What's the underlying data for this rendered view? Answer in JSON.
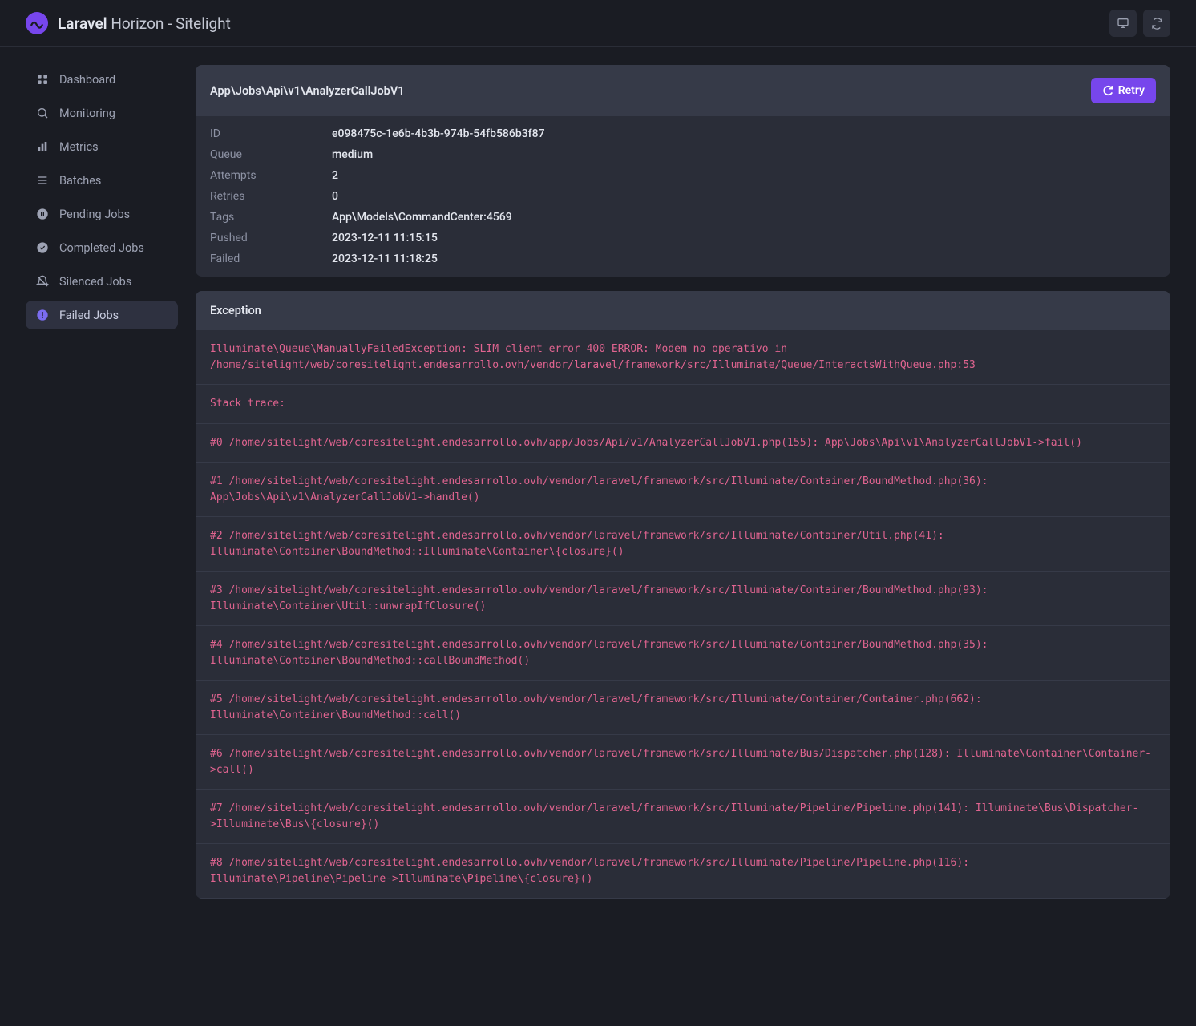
{
  "brand": {
    "bold": "Laravel",
    "rest": " Horizon - Sitelight"
  },
  "sidebar": {
    "items": [
      {
        "label": "Dashboard",
        "icon": "grid"
      },
      {
        "label": "Monitoring",
        "icon": "search"
      },
      {
        "label": "Metrics",
        "icon": "bars"
      },
      {
        "label": "Batches",
        "icon": "lines"
      },
      {
        "label": "Pending Jobs",
        "icon": "pause"
      },
      {
        "label": "Completed Jobs",
        "icon": "check"
      },
      {
        "label": "Silenced Jobs",
        "icon": "bell-off"
      },
      {
        "label": "Failed Jobs",
        "icon": "alert",
        "active": true
      }
    ]
  },
  "job": {
    "title": "App\\Jobs\\Api\\v1\\AnalyzerCallJobV1",
    "retry_label": "Retry",
    "details": [
      {
        "label": "ID",
        "value": "e098475c-1e6b-4b3b-974b-54fb586b3f87"
      },
      {
        "label": "Queue",
        "value": "medium"
      },
      {
        "label": "Attempts",
        "value": "2"
      },
      {
        "label": "Retries",
        "value": "0"
      },
      {
        "label": "Tags",
        "value": "App\\Models\\CommandCenter:4569"
      },
      {
        "label": "Pushed",
        "value": "2023-12-11 11:15:15"
      },
      {
        "label": "Failed",
        "value": "2023-12-11 11:18:25"
      }
    ]
  },
  "exception": {
    "title": "Exception",
    "lines": [
      "Illuminate\\Queue\\ManuallyFailedException: SLIM client error 400 ERROR: Modem no operativo in /home/sitelight/web/coresitelight.endesarrollo.ovh/vendor/laravel/framework/src/Illuminate/Queue/InteractsWithQueue.php:53",
      "Stack trace:",
      "#0 /home/sitelight/web/coresitelight.endesarrollo.ovh/app/Jobs/Api/v1/AnalyzerCallJobV1.php(155): App\\Jobs\\Api\\v1\\AnalyzerCallJobV1->fail()",
      "#1 /home/sitelight/web/coresitelight.endesarrollo.ovh/vendor/laravel/framework/src/Illuminate/Container/BoundMethod.php(36): App\\Jobs\\Api\\v1\\AnalyzerCallJobV1->handle()",
      "#2 /home/sitelight/web/coresitelight.endesarrollo.ovh/vendor/laravel/framework/src/Illuminate/Container/Util.php(41): Illuminate\\Container\\BoundMethod::Illuminate\\Container\\{closure}()",
      "#3 /home/sitelight/web/coresitelight.endesarrollo.ovh/vendor/laravel/framework/src/Illuminate/Container/BoundMethod.php(93): Illuminate\\Container\\Util::unwrapIfClosure()",
      "#4 /home/sitelight/web/coresitelight.endesarrollo.ovh/vendor/laravel/framework/src/Illuminate/Container/BoundMethod.php(35): Illuminate\\Container\\BoundMethod::callBoundMethod()",
      "#5 /home/sitelight/web/coresitelight.endesarrollo.ovh/vendor/laravel/framework/src/Illuminate/Container/Container.php(662): Illuminate\\Container\\BoundMethod::call()",
      "#6 /home/sitelight/web/coresitelight.endesarrollo.ovh/vendor/laravel/framework/src/Illuminate/Bus/Dispatcher.php(128): Illuminate\\Container\\Container->call()",
      "#7 /home/sitelight/web/coresitelight.endesarrollo.ovh/vendor/laravel/framework/src/Illuminate/Pipeline/Pipeline.php(141): Illuminate\\Bus\\Dispatcher->Illuminate\\Bus\\{closure}()",
      "#8 /home/sitelight/web/coresitelight.endesarrollo.ovh/vendor/laravel/framework/src/Illuminate/Pipeline/Pipeline.php(116): Illuminate\\Pipeline\\Pipeline->Illuminate\\Pipeline\\{closure}()"
    ]
  }
}
